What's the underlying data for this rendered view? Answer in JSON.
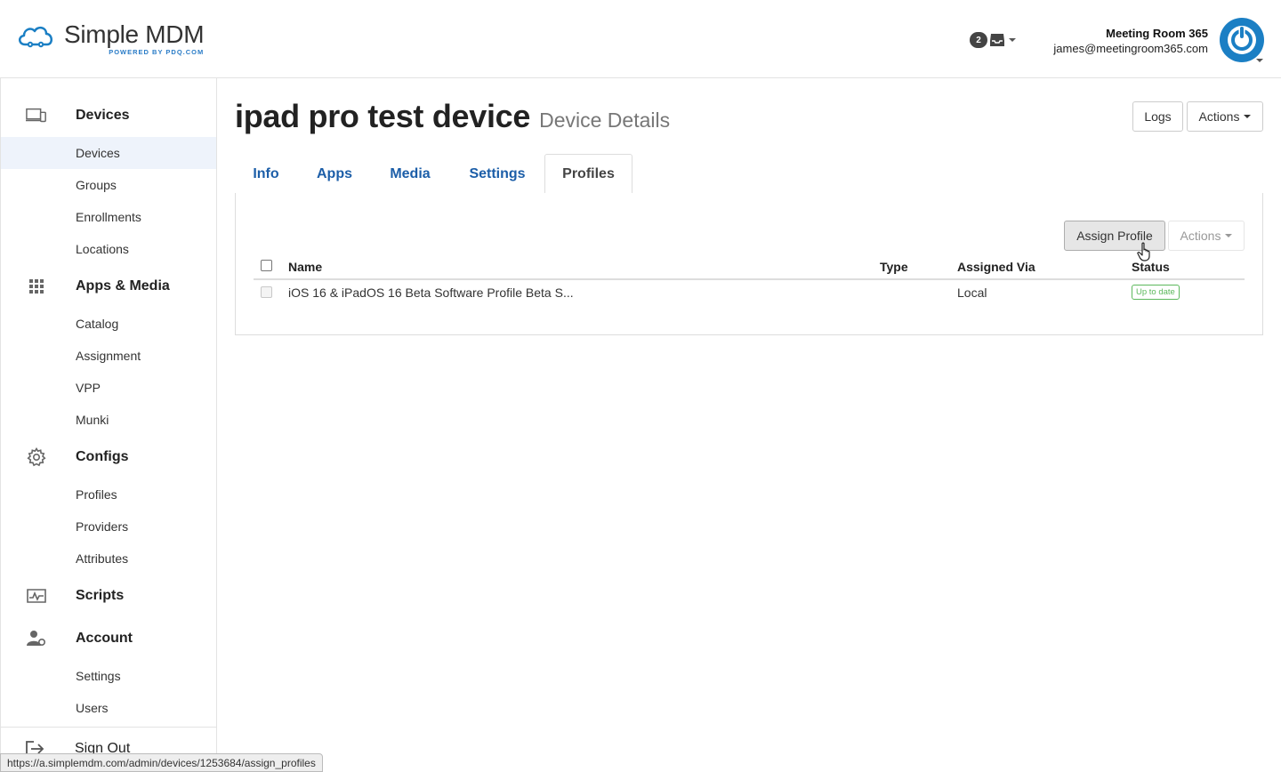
{
  "header": {
    "logo_title": "Simple MDM",
    "logo_subtitle": "POWERED BY PDQ.COM",
    "notification_count": "2",
    "account_name": "Meeting Room 365",
    "account_email": "james@meetingroom365.com"
  },
  "sidebar": {
    "devices_section": "Devices",
    "devices_items": [
      "Devices",
      "Groups",
      "Enrollments",
      "Locations"
    ],
    "apps_section": "Apps & Media",
    "apps_items": [
      "Catalog",
      "Assignment",
      "VPP",
      "Munki"
    ],
    "configs_section": "Configs",
    "configs_items": [
      "Profiles",
      "Providers",
      "Attributes"
    ],
    "scripts_section": "Scripts",
    "account_section": "Account",
    "account_items": [
      "Settings",
      "Users"
    ],
    "sign_out": "Sign Out",
    "active_item": "Devices"
  },
  "main": {
    "title": "ipad pro test device",
    "subtitle": "Device Details",
    "logs_label": "Logs",
    "actions_label": "Actions",
    "tabs": [
      "Info",
      "Apps",
      "Media",
      "Settings",
      "Profiles"
    ],
    "active_tab": "Profiles",
    "assign_profile_label": "Assign Profile",
    "panel_actions_label": "Actions",
    "table": {
      "columns": [
        "Name",
        "Type",
        "Assigned Via",
        "Status"
      ],
      "rows": [
        {
          "name": "iOS 16 & iPadOS 16 Beta Software Profile Beta S...",
          "type": "",
          "assigned_via": "Local",
          "status": "Up to date"
        }
      ]
    }
  },
  "status_bar_url": "https://a.simplemdm.com/admin/devices/1253684/assign_profiles",
  "colors": {
    "brand_blue": "#1b7fc4",
    "tab_link": "#1c5ea8",
    "status_green": "#5cb85c",
    "active_item_bg": "#eef3fb"
  }
}
